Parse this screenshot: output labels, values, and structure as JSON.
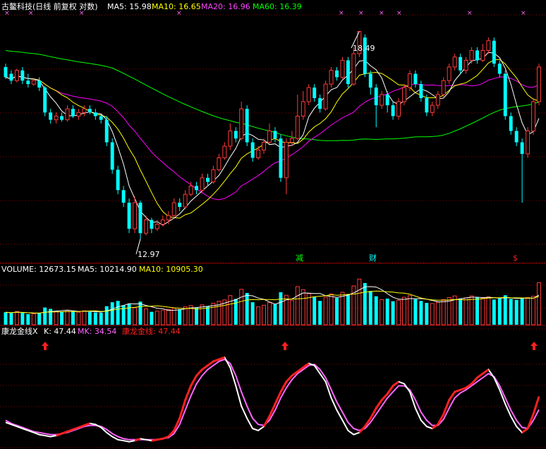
{
  "colors": {
    "background": "#000000",
    "grid": "#8b0000",
    "up_candle": "#ff3b3b",
    "down_candle": "#00ffff",
    "ma5": "#ffffff",
    "ma10": "#ffff00",
    "ma20": "#ff00ff",
    "ma60": "#00ff00",
    "k_line": "#ffffff",
    "mk_line": "#ff66ff",
    "gold_line": "#ff2020",
    "marker": "#ff66ff",
    "up_arrow": "#ff2020"
  },
  "header": {
    "title": "古鳌科技(日线 前复权 对数)",
    "ma5": "MA5: 15.98",
    "ma10": "MA10: 16.65",
    "ma20": "MA20: 16.96",
    "ma60": "MA60: 16.39"
  },
  "volume_header": {
    "label": "VOLUME: 12673.15",
    "ma5": "MA5: 10214.90",
    "ma10": "MA10: 10905.30"
  },
  "indicator_header": {
    "name": "康龙金线X",
    "k": "K: 47.44",
    "mk": "MK: 34.54",
    "gold": "康龙金线: 47.44"
  },
  "annotations": {
    "high": "18.49",
    "low": "12.97",
    "event_jian": "减",
    "event_cai": "财",
    "event_s": "$"
  },
  "chart_data": {
    "type": "candlestick",
    "title": "古鳌科技(日线 前复权 对数)",
    "price_range": [
      12.7,
      19.0
    ],
    "high_label": 18.49,
    "low_label": 12.97,
    "candles": [
      [
        17.4,
        17.1,
        17.5,
        17.05
      ],
      [
        17.2,
        17.0,
        17.3,
        16.9
      ],
      [
        17.0,
        17.3,
        17.35,
        16.95
      ],
      [
        17.3,
        17.0,
        17.4,
        16.9
      ],
      [
        17.0,
        16.9,
        17.2,
        16.8
      ],
      [
        16.9,
        17.0,
        17.05,
        16.85
      ],
      [
        17.0,
        16.8,
        17.1,
        16.7
      ],
      [
        16.8,
        16.1,
        16.85,
        16.0
      ],
      [
        16.1,
        15.9,
        16.2,
        15.8
      ],
      [
        15.9,
        16.0,
        16.1,
        15.8
      ],
      [
        16.0,
        15.9,
        16.1,
        15.85
      ],
      [
        15.9,
        16.2,
        16.3,
        15.85
      ],
      [
        16.2,
        16.0,
        16.3,
        15.95
      ],
      [
        16.0,
        16.1,
        16.2,
        15.9
      ],
      [
        16.1,
        16.2,
        16.3,
        16.0
      ],
      [
        16.2,
        16.1,
        16.3,
        16.05
      ],
      [
        16.1,
        16.0,
        16.2,
        15.9
      ],
      [
        16.0,
        15.9,
        16.05,
        15.8
      ],
      [
        15.9,
        15.3,
        16.0,
        15.2
      ],
      [
        15.3,
        14.6,
        15.4,
        14.5
      ],
      [
        14.6,
        14.1,
        14.7,
        14.0
      ],
      [
        14.1,
        13.8,
        14.2,
        13.7
      ],
      [
        13.8,
        13.2,
        13.9,
        13.1
      ],
      [
        13.2,
        13.8,
        13.95,
        13.1
      ],
      [
        13.8,
        13.1,
        13.85,
        12.97
      ],
      [
        13.1,
        13.4,
        13.5,
        13.05
      ],
      [
        13.4,
        13.2,
        13.45,
        13.1
      ],
      [
        13.2,
        13.3,
        13.4,
        13.15
      ],
      [
        13.3,
        13.4,
        13.5,
        13.25
      ],
      [
        13.4,
        13.5,
        13.6,
        13.3
      ],
      [
        13.5,
        13.8,
        13.9,
        13.45
      ],
      [
        13.8,
        13.7,
        13.9,
        13.6
      ],
      [
        13.7,
        14.0,
        14.1,
        13.65
      ],
      [
        14.0,
        14.2,
        14.3,
        13.95
      ],
      [
        14.2,
        14.1,
        14.3,
        14.0
      ],
      [
        14.1,
        14.4,
        14.5,
        14.05
      ],
      [
        14.4,
        14.3,
        14.5,
        14.2
      ],
      [
        14.3,
        14.6,
        14.7,
        14.25
      ],
      [
        14.6,
        14.9,
        15.0,
        14.55
      ],
      [
        14.9,
        15.2,
        15.3,
        14.85
      ],
      [
        15.2,
        15.6,
        15.8,
        15.1
      ],
      [
        15.6,
        15.4,
        15.7,
        15.3
      ],
      [
        15.4,
        16.2,
        16.4,
        15.35
      ],
      [
        16.2,
        15.3,
        16.3,
        15.2
      ],
      [
        15.3,
        14.9,
        15.4,
        14.8
      ],
      [
        14.9,
        15.1,
        15.2,
        14.85
      ],
      [
        15.1,
        15.3,
        15.4,
        15.0
      ],
      [
        15.3,
        15.6,
        15.8,
        15.25
      ],
      [
        15.6,
        15.4,
        15.7,
        15.3
      ],
      [
        15.4,
        14.4,
        15.5,
        14.3
      ],
      [
        14.4,
        15.3,
        15.4,
        14.0
      ],
      [
        15.3,
        15.4,
        15.6,
        15.2
      ],
      [
        15.4,
        16.0,
        16.6,
        15.35
      ],
      [
        16.0,
        16.4,
        16.7,
        15.9
      ],
      [
        16.4,
        16.8,
        16.9,
        16.3
      ],
      [
        16.8,
        16.5,
        16.9,
        16.4
      ],
      [
        16.5,
        16.2,
        16.6,
        16.1
      ],
      [
        16.2,
        16.9,
        17.0,
        16.15
      ],
      [
        16.9,
        17.3,
        17.4,
        16.8
      ],
      [
        17.3,
        17.1,
        17.4,
        17.0
      ],
      [
        17.1,
        17.6,
        17.7,
        17.05
      ],
      [
        17.6,
        16.9,
        17.7,
        16.8
      ],
      [
        16.9,
        17.8,
        18.0,
        16.85
      ],
      [
        17.8,
        18.49,
        18.49,
        17.7
      ],
      [
        18.3,
        17.2,
        18.4,
        17.1
      ],
      [
        17.2,
        16.8,
        17.3,
        16.6
      ],
      [
        16.8,
        16.3,
        16.9,
        15.7
      ],
      [
        16.3,
        16.6,
        16.7,
        16.2
      ],
      [
        16.6,
        16.3,
        16.7,
        16.1
      ],
      [
        16.3,
        16.0,
        16.4,
        15.9
      ],
      [
        16.0,
        16.4,
        16.5,
        15.9
      ],
      [
        16.4,
        16.8,
        16.9,
        16.3
      ],
      [
        16.8,
        17.2,
        17.3,
        16.7
      ],
      [
        17.2,
        16.9,
        17.3,
        16.8
      ],
      [
        16.9,
        16.5,
        17.0,
        16.4
      ],
      [
        16.5,
        16.1,
        16.6,
        16.0
      ],
      [
        16.1,
        16.3,
        16.4,
        16.0
      ],
      [
        16.3,
        16.6,
        16.7,
        16.2
      ],
      [
        16.6,
        17.0,
        17.1,
        16.5
      ],
      [
        17.0,
        17.4,
        17.5,
        16.9
      ],
      [
        17.4,
        17.7,
        17.8,
        17.3
      ],
      [
        17.7,
        17.3,
        17.8,
        17.2
      ],
      [
        17.3,
        17.6,
        17.7,
        17.2
      ],
      [
        17.6,
        17.9,
        18.0,
        17.5
      ],
      [
        17.9,
        17.6,
        18.0,
        17.5
      ],
      [
        17.6,
        17.9,
        18.1,
        17.55
      ],
      [
        17.9,
        18.2,
        18.3,
        17.8
      ],
      [
        18.2,
        17.5,
        18.3,
        17.4
      ],
      [
        17.5,
        17.2,
        17.6,
        17.1
      ],
      [
        17.2,
        16.0,
        17.3,
        15.9
      ],
      [
        16.0,
        15.6,
        16.1,
        15.5
      ],
      [
        15.6,
        15.3,
        15.7,
        15.2
      ],
      [
        15.3,
        15.0,
        15.4,
        13.8
      ],
      [
        15.0,
        15.6,
        15.7,
        14.9
      ],
      [
        15.6,
        16.4,
        16.5,
        15.5
      ],
      [
        16.4,
        17.4,
        17.5,
        16.3
      ]
    ],
    "ma5_last": 15.98,
    "ma10_last": 16.65,
    "ma20_last": 16.96,
    "ma60_last": 16.39,
    "volume": [
      3800,
      3500,
      4000,
      3600,
      3200,
      3300,
      3400,
      5200,
      4800,
      4000,
      3900,
      4300,
      4100,
      3800,
      4200,
      3900,
      3700,
      3600,
      5600,
      6800,
      7200,
      5900,
      6400,
      5100,
      7000,
      4800,
      3900,
      4100,
      4300,
      4600,
      5000,
      4700,
      5400,
      5800,
      5100,
      6000,
      5500,
      6500,
      7100,
      7500,
      8800,
      7800,
      10700,
      9600,
      6800,
      5400,
      5900,
      6700,
      6200,
      9800,
      8900,
      7300,
      11500,
      10600,
      9400,
      8400,
      7200,
      8300,
      9300,
      8100,
      9800,
      9200,
      11700,
      13800,
      12600,
      10200,
      8600,
      7600,
      7900,
      7100,
      7400,
      8300,
      8800,
      7700,
      7200,
      6600,
      6400,
      6800,
      7600,
      8200,
      8700,
      7900,
      8100,
      8700,
      8200,
      8000,
      8400,
      7600,
      7900,
      8900,
      7800,
      7500,
      7900,
      8200,
      8600,
      12673
    ],
    "vol_ma5_last": 10214.9,
    "vol_ma10_last": 10905.3,
    "k": [
      22,
      20,
      18,
      16,
      14,
      12,
      10,
      9,
      8,
      9,
      11,
      13,
      15,
      17,
      19,
      21,
      20,
      17,
      12,
      8,
      5,
      4,
      3,
      4,
      6,
      5,
      4,
      5,
      6,
      8,
      14,
      26,
      44,
      58,
      68,
      74,
      78,
      82,
      84,
      86,
      76,
      58,
      38,
      26,
      16,
      14,
      18,
      28,
      40,
      52,
      62,
      68,
      72,
      76,
      80,
      78,
      70,
      62,
      46,
      34,
      24,
      14,
      10,
      12,
      18,
      26,
      36,
      44,
      50,
      58,
      62,
      60,
      52,
      36,
      24,
      18,
      16,
      20,
      30,
      44,
      52,
      54,
      56,
      60,
      66,
      70,
      74,
      66,
      54,
      40,
      28,
      18,
      12,
      16,
      30,
      47.44
    ],
    "mk": [
      24,
      21,
      19,
      17,
      15,
      13,
      12,
      11,
      10,
      10,
      11,
      12,
      14,
      16,
      18,
      19,
      19,
      18,
      15,
      11,
      8,
      6,
      5,
      5,
      5,
      5,
      5,
      5,
      6,
      7,
      11,
      20,
      34,
      48,
      60,
      68,
      74,
      78,
      82,
      84,
      80,
      68,
      52,
      38,
      26,
      20,
      19,
      24,
      34,
      46,
      56,
      64,
      70,
      74,
      78,
      79,
      74,
      66,
      54,
      42,
      32,
      22,
      16,
      14,
      16,
      22,
      30,
      38,
      46,
      52,
      58,
      58,
      54,
      44,
      32,
      24,
      19,
      19,
      25,
      36,
      46,
      51,
      54,
      58,
      62,
      66,
      70,
      67,
      58,
      46,
      34,
      24,
      17,
      16,
      24,
      34.54
    ],
    "k_last": 47.44,
    "mk_last": 34.54,
    "gold_last": 47.44
  }
}
